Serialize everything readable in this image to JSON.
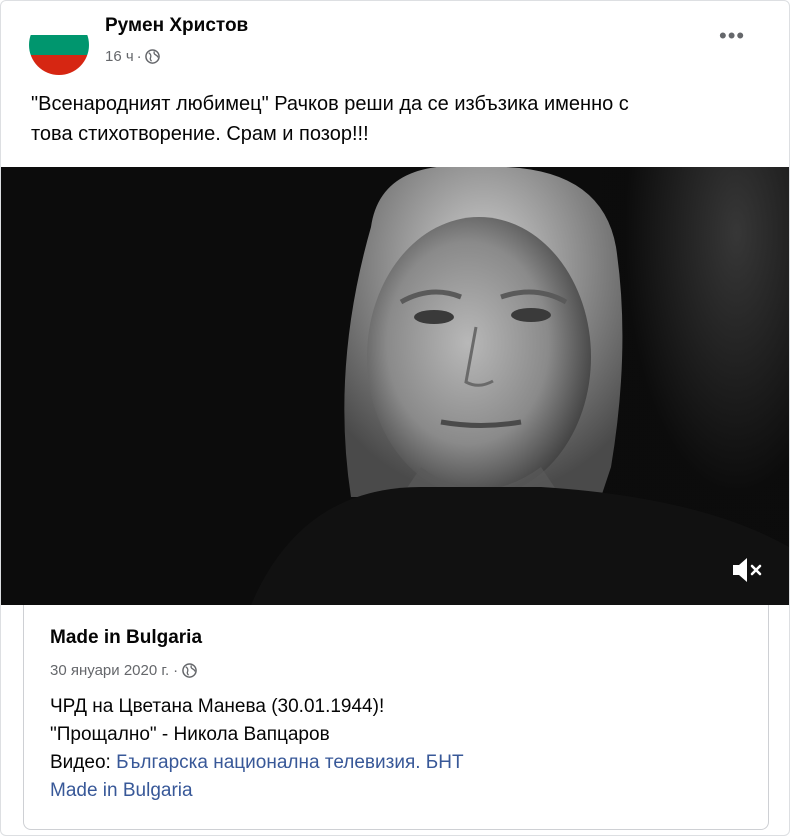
{
  "post": {
    "author": "Румен Христов",
    "time": "16 ч",
    "separator": "·",
    "text_line1": "\"Всенародният любимец\" Рачков реши да се избъзика именно с",
    "text_line2": "това стихотворение. Срам и позор!!!"
  },
  "avatar": {
    "colors": [
      "#ffffff",
      "#00966e",
      "#d62612"
    ]
  },
  "shared_post": {
    "author": "Made in Bulgaria",
    "date": "30 януари 2020 г.",
    "separator": "·",
    "line1": "ЧРД на Цветана Манева (30.01.1944)!",
    "line2": "\"Прощално\" - Никола Вапцаров",
    "line3_prefix": "Видео: ",
    "line3_link": "Българска национална телевизия. БНТ",
    "line4_link": "Made in Bulgaria"
  },
  "video": {
    "muted": true
  }
}
